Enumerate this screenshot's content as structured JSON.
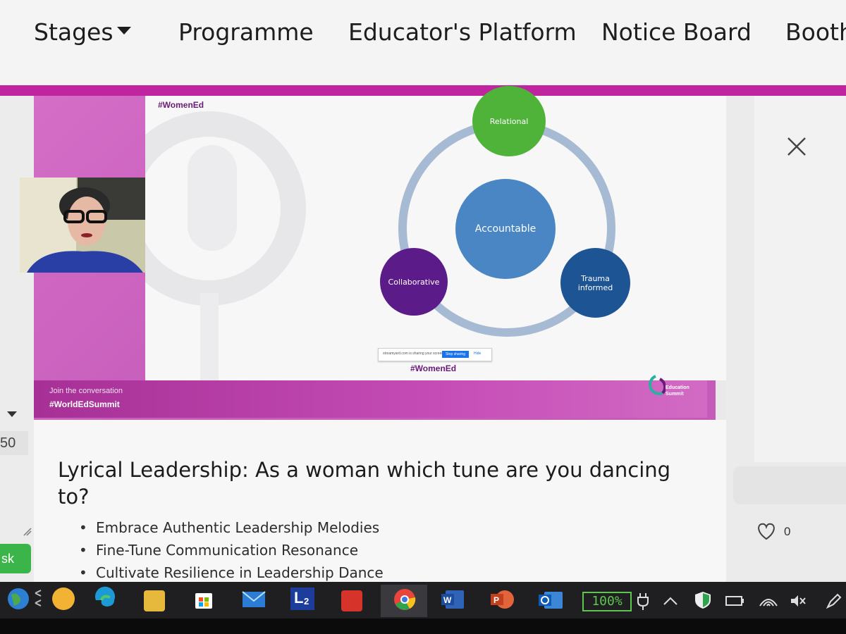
{
  "nav": {
    "items": [
      {
        "label": "Stages",
        "has_dropdown": true
      },
      {
        "label": "Programme"
      },
      {
        "label": "Educator's Platform"
      },
      {
        "label": "Notice Board"
      },
      {
        "label": "Booth"
      }
    ]
  },
  "slide": {
    "tag_top": "#WomenEd",
    "circles": {
      "center": "Accountable",
      "top": "Relational",
      "left": "Collaborative",
      "right_line1": "Trauma",
      "right_line2": "informed"
    },
    "share_bar": {
      "text": "streamyard.com is sharing your screen.",
      "stop_label": "Stop sharing",
      "hide_label": "Hide"
    },
    "tag_bottom": "#WomenEd"
  },
  "footer": {
    "join_text": "Join the conversation",
    "hashtag": "#WorldEdSummit",
    "logo_line1": "Education",
    "logo_line2": "Summit"
  },
  "left_partial": {
    "count": "50",
    "button": "sk"
  },
  "session": {
    "title": "Lyrical Leadership: As a woman which tune are you dancing to?",
    "bullets": [
      "Embrace Authentic Leadership Melodies",
      "Fine-Tune Communication Resonance",
      "Cultivate Resilience in Leadership Dance"
    ]
  },
  "likes": {
    "count": "0"
  },
  "taskbar": {
    "battery": "100%",
    "badge_l_number": "2"
  },
  "colors": {
    "magenta": "#c0249f",
    "accountable": "#4a86c3",
    "relational": "#4fb33a",
    "collaborative": "#5b1c8a",
    "trauma": "#1d5493",
    "ring": "#a7bad3"
  }
}
